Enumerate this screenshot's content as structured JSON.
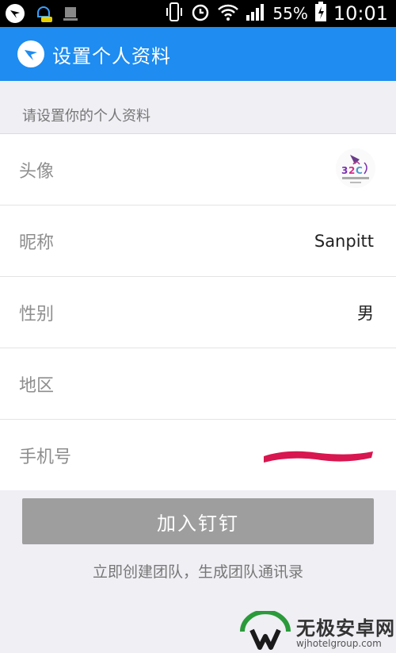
{
  "status_bar": {
    "battery": "55%",
    "time": "10:01"
  },
  "header": {
    "title": "设置个人资料"
  },
  "hint": "请设置你的个人资料",
  "rows": [
    {
      "label": "头像",
      "value": ""
    },
    {
      "label": "昵称",
      "value": "Sanpitt"
    },
    {
      "label": "性别",
      "value": "男"
    },
    {
      "label": "地区",
      "value": ""
    },
    {
      "label": "手机号",
      "value": ""
    }
  ],
  "join_button": "加入钉钉",
  "create_team_link": "立即创建团队，生成团队通讯录",
  "watermark": {
    "main": "无极安卓网",
    "sub": "wjhotelgroup.com"
  },
  "colors": {
    "header": "#1e8cf0",
    "button": "#9e9e9e",
    "redaction": "#d8164f"
  }
}
